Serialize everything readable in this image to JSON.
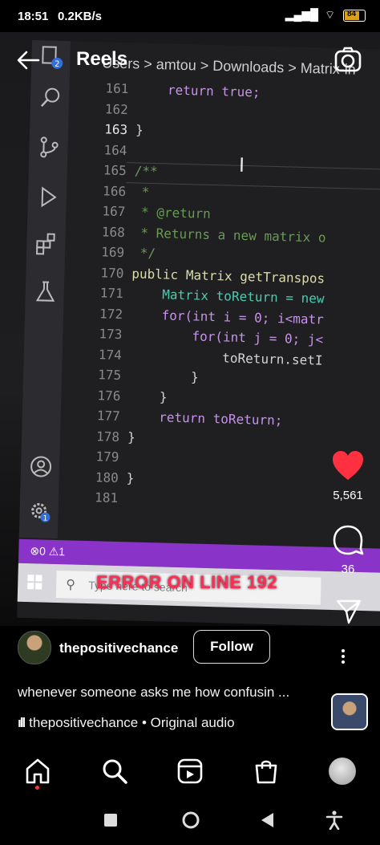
{
  "status_bar": {
    "time": "18:51",
    "network_speed": "0.2KB/s",
    "battery": "84"
  },
  "header": {
    "title": "Reels"
  },
  "video": {
    "breadcrumb": "Users > amtou > Downloads > Matrix-in",
    "line_numbers": [
      "161",
      "162",
      "163",
      "164",
      "165",
      "166",
      "167",
      "168",
      "169",
      "170",
      "171",
      "172",
      "173",
      "174",
      "175",
      "176",
      "177",
      "178",
      "179",
      "180",
      "181"
    ],
    "active_line": "163",
    "code_lines": [
      "    return true;",
      "",
      "}",
      "",
      "/**",
      " *",
      " * @return",
      " * Returns a new matrix o",
      " */",
      "public Matrix getTranspos",
      "    Matrix toReturn = new",
      "    for(int i = 0; i<matr",
      "        for(int j = 0; j<",
      "            toReturn.setI",
      "        }",
      "    }",
      "    return toReturn;",
      "}",
      "",
      "}",
      ""
    ],
    "status_errors": "⊗0 ⚠1",
    "error_banner": "ERROR ON LINE 192",
    "taskbar_search_placeholder": "Type here to search",
    "activity_badges": {
      "explorer": "2",
      "settings": "1"
    }
  },
  "rail": {
    "like_count": "5,561",
    "comment_count": "36"
  },
  "post": {
    "username": "thepositivechance",
    "follow_label": "Follow",
    "caption": "whenever someone asks me how confusin ...",
    "audio": "thepositivechance • Original audio"
  },
  "colors": {
    "like_red": "#ff3040",
    "vscode_status": "#8a33c9",
    "error_text": "#ff2d55"
  }
}
